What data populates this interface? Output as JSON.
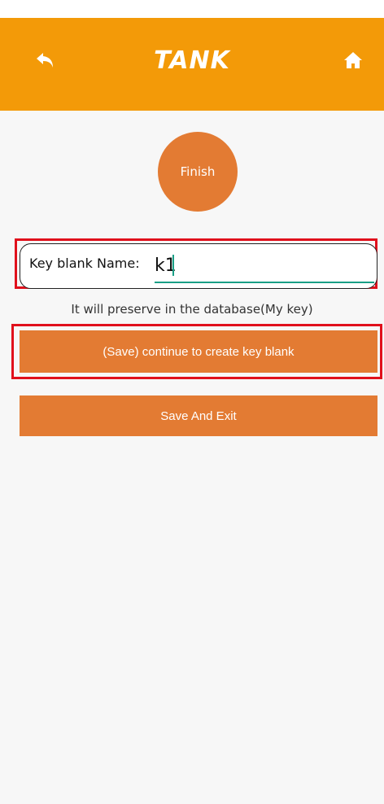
{
  "header": {
    "logo_text": "TANK",
    "back_icon": "back-arrow-icon",
    "home_icon": "home-icon"
  },
  "finish": {
    "label": "Finish"
  },
  "key_blank": {
    "label": "Key blank Name:",
    "value": "k1"
  },
  "hint": "It will preserve in the database(My key)",
  "buttons": {
    "continue_label": "(Save) continue to create key blank",
    "save_exit_label": "Save And Exit"
  },
  "colors": {
    "header_bg": "#f39a08",
    "button_bg": "#e37b33",
    "highlight": "#e0101c",
    "input_underline": "#1a9f86"
  }
}
